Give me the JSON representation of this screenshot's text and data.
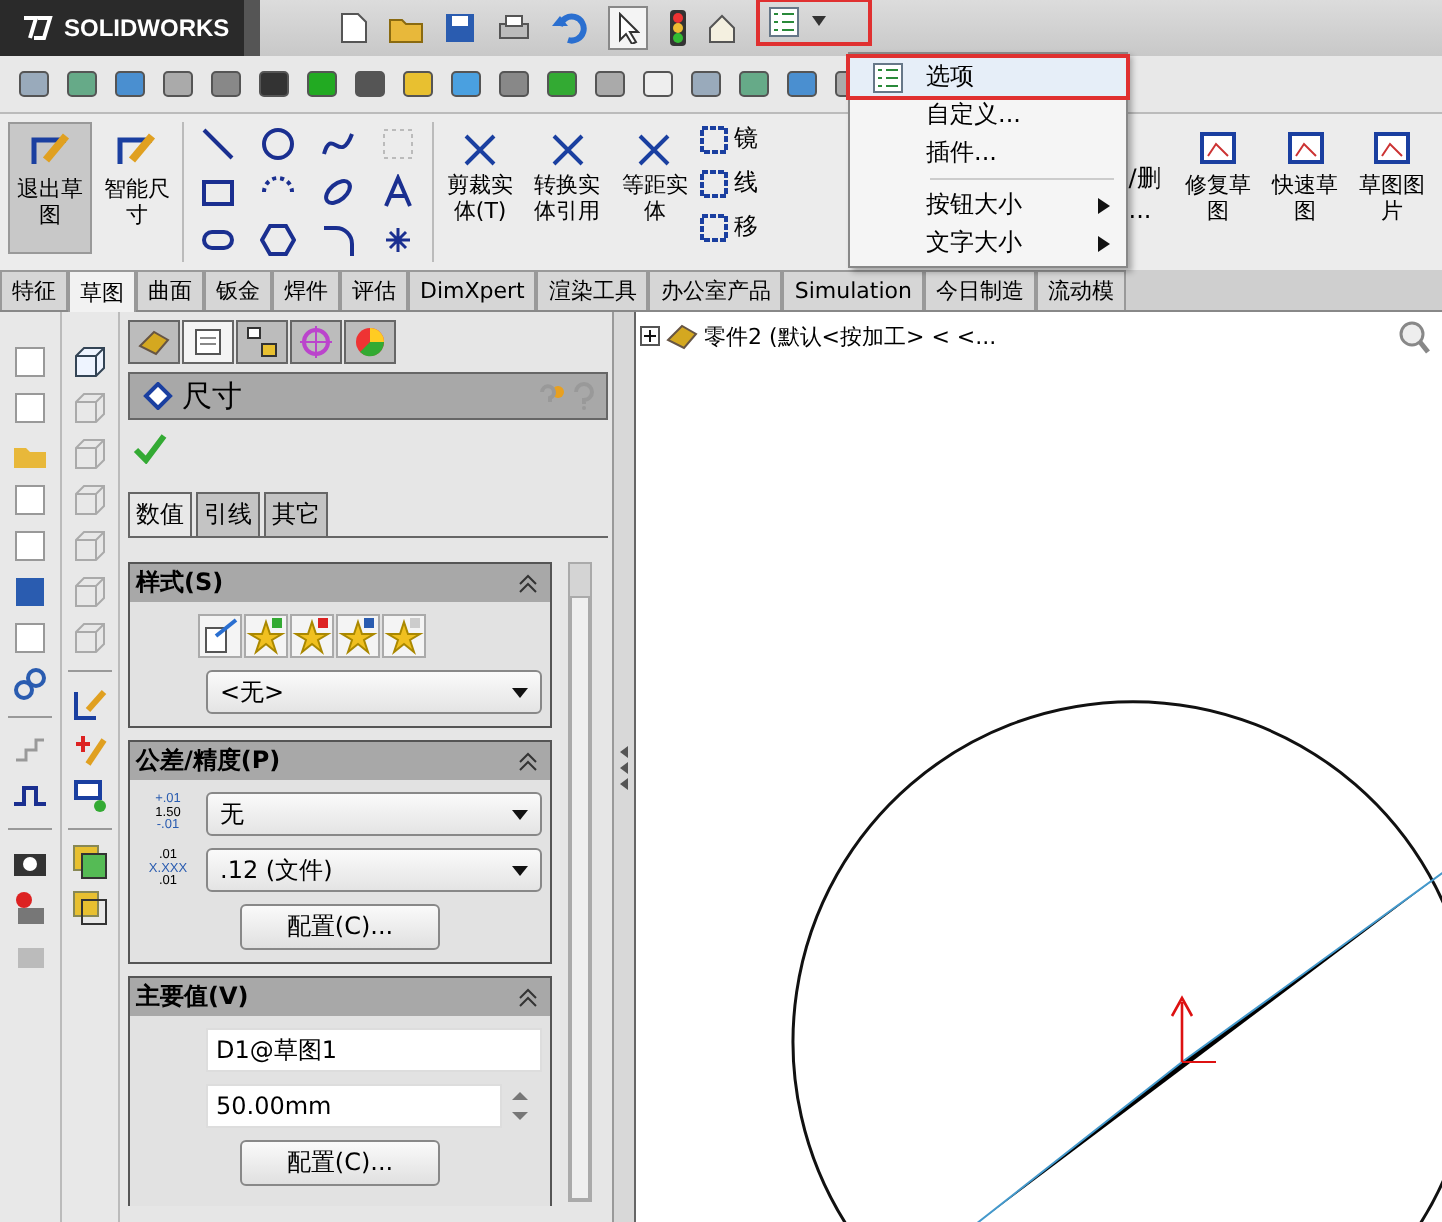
{
  "title_bar": {
    "logo": "SOLIDWORKS"
  },
  "ribbon": {
    "buttons": [
      {
        "label": "退出草图",
        "selected": true
      },
      {
        "label": "智能尺寸",
        "selected": false
      }
    ],
    "edit_buttons": [
      {
        "label": "剪裁实体(T)"
      },
      {
        "label": "转换实体引用"
      },
      {
        "label": "等距实体"
      }
    ],
    "partial_labels": [
      "镜",
      "线",
      "移"
    ],
    "hidden_button": {
      "line_1": "/删",
      "line_2": "..."
    },
    "right_buttons": [
      {
        "label": "修复草图"
      },
      {
        "label": "快速草图"
      },
      {
        "label": "草图图片"
      }
    ]
  },
  "options_menu": {
    "items": [
      {
        "label": "选项",
        "kind": "item",
        "selected": true
      },
      {
        "label": "自定义...",
        "kind": "item",
        "selected": false
      },
      {
        "label": "插件...",
        "kind": "item",
        "selected": false
      },
      {
        "label": "按钮大小",
        "kind": "submenu",
        "selected": false
      },
      {
        "label": "文字大小",
        "kind": "submenu",
        "selected": false
      }
    ]
  },
  "command_tabs": [
    {
      "label": "特征",
      "selected": false
    },
    {
      "label": "草图",
      "selected": true
    },
    {
      "label": "曲面",
      "selected": false
    },
    {
      "label": "钣金",
      "selected": false
    },
    {
      "label": "焊件",
      "selected": false
    },
    {
      "label": "评估",
      "selected": false
    },
    {
      "label": "DimXpert",
      "selected": false
    },
    {
      "label": "渲染工具",
      "selected": false
    },
    {
      "label": "办公室产品",
      "selected": false
    },
    {
      "label": "Simulation",
      "selected": false
    },
    {
      "label": "今日制造",
      "selected": false
    },
    {
      "label": "流动模",
      "selected": false
    }
  ],
  "property_manager": {
    "panel_tabs": [
      {
        "selected": false
      },
      {
        "selected": true
      },
      {
        "selected": false
      },
      {
        "selected": false
      },
      {
        "selected": false
      }
    ],
    "title": "尺寸",
    "tabs": [
      {
        "label": "数值",
        "selected": true
      },
      {
        "label": "引线",
        "selected": false
      },
      {
        "label": "其它",
        "selected": false
      }
    ],
    "style_section": {
      "title": "样式(S)",
      "dropdown": "<无>"
    },
    "tolerance_section": {
      "title": "公差/精度(P)",
      "tolerance_icon": [
        "+.01",
        "1.50",
        "-.01"
      ],
      "tolerance_type": "无",
      "precision_icon": [
        ".01",
        "X.XXX",
        ".01"
      ],
      "precision": ".12 (文件)",
      "config_button": "配置(C)..."
    },
    "primary_value_section": {
      "title": "主要值(V)",
      "name": "D1@草图1",
      "value": "50.00mm",
      "config_button": "配置(C)..."
    }
  },
  "feature_tree": {
    "root": "零件2 (默认<按加工> < <..."
  }
}
